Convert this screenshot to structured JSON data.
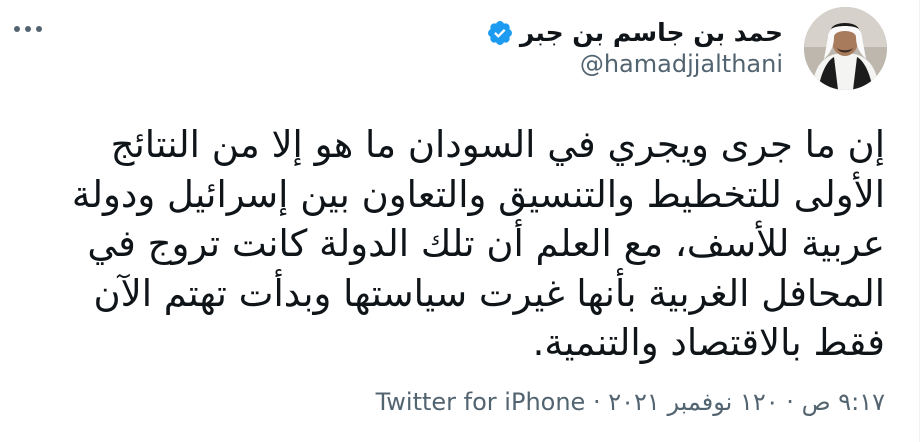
{
  "author": {
    "display_name": "حمد بن جاسم بن جبر",
    "handle": "@hamadjjalthani"
  },
  "tweet": {
    "lines": [
      "إن ما جرى ويجري في السودان ما هو إلا من النتائج",
      "الأولى للتخطيط والتنسيق والتعاون بين إسرائيل ودولة",
      "عربية للأسف، مع العلم أن تلك الدولة كانت تروج في",
      "المحافل الغربية بأنها غيرت سياستها وبدأت تهتم الآن",
      "فقط بالاقتصاد والتنمية."
    ]
  },
  "meta": {
    "time": "٩:١٧ ص",
    "date": "١٢٠ نوفمبر ٢٠٢١",
    "separator": "·",
    "source": "Twitter for iPhone"
  },
  "icons": {
    "verified": "verified-badge-icon",
    "more": "more-options-icon"
  },
  "colors": {
    "verified_blue": "#1d9bf0",
    "secondary_text": "#536471"
  }
}
